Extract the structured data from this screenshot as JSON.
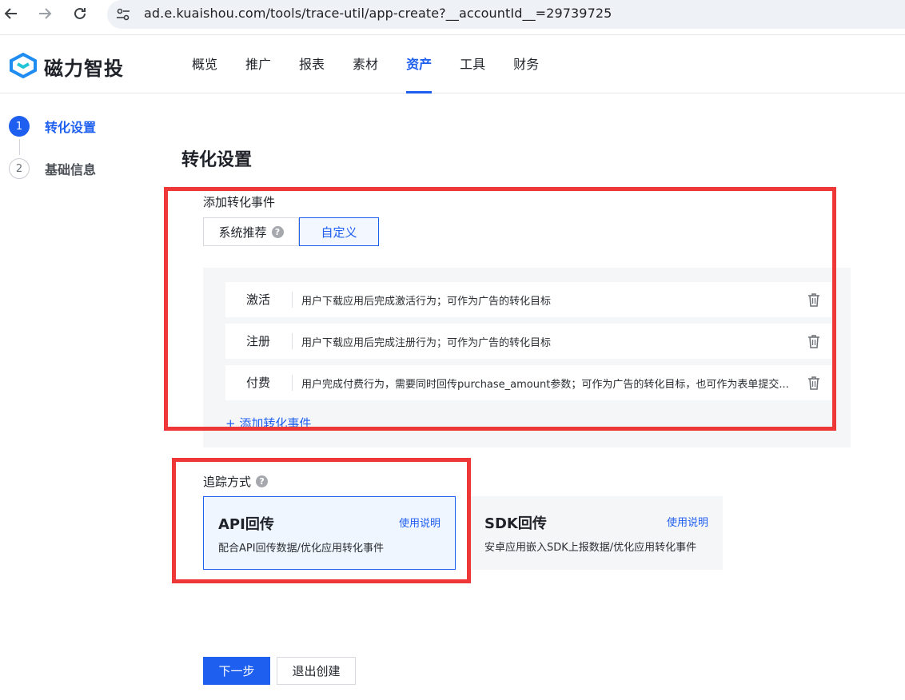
{
  "browser": {
    "back_icon": "arrow-left-icon",
    "forward_icon": "arrow-right-icon",
    "reload_icon": "reload-icon",
    "site_settings_icon": "tune-icon",
    "url": "ad.e.kuaishou.com/tools/trace-util/app-create?__accountId__=29739725"
  },
  "header": {
    "logo_icon": "magnet-logo-icon",
    "logo_text": "磁力智投",
    "nav_tabs": [
      {
        "label": "概览",
        "active": false
      },
      {
        "label": "推广",
        "active": false
      },
      {
        "label": "报表",
        "active": false
      },
      {
        "label": "素材",
        "active": false
      },
      {
        "label": "资产",
        "active": true
      },
      {
        "label": "工具",
        "active": false
      },
      {
        "label": "财务",
        "active": false
      }
    ]
  },
  "steps": [
    {
      "number": "1",
      "label": "转化设置",
      "active": true
    },
    {
      "number": "2",
      "label": "基础信息",
      "active": false
    }
  ],
  "page_title": "转化设置",
  "conversion": {
    "section_label": "添加转化事件",
    "segments": {
      "system": "系统推荐",
      "custom": "自定义"
    },
    "events": [
      {
        "name": "激活",
        "desc": "用户下载应用后完成激活行为；可作为广告的转化目标"
      },
      {
        "name": "注册",
        "desc": "用户下载应用后完成注册行为；可作为广告的转化目标"
      },
      {
        "name": "付费",
        "desc": "用户完成付费行为，需要同时回传purchase_amount参数；可作为广告的转化目标，也可作为表单提交..."
      }
    ],
    "add_event_label": "+ 添加转化事件"
  },
  "tracking": {
    "section_label": "追踪方式",
    "cards": [
      {
        "title": "API回传",
        "link": "使用说明",
        "desc": "配合API回传数据/优化应用转化事件",
        "selected": true
      },
      {
        "title": "SDK回传",
        "link": "使用说明",
        "desc": "安卓应用嵌入SDK上报数据/优化应用转化事件",
        "selected": false
      }
    ]
  },
  "footer": {
    "next_label": "下一步",
    "exit_label": "退出创建"
  },
  "colors": {
    "primary": "#1e5ff0",
    "annotation_red": "#ee3838"
  }
}
